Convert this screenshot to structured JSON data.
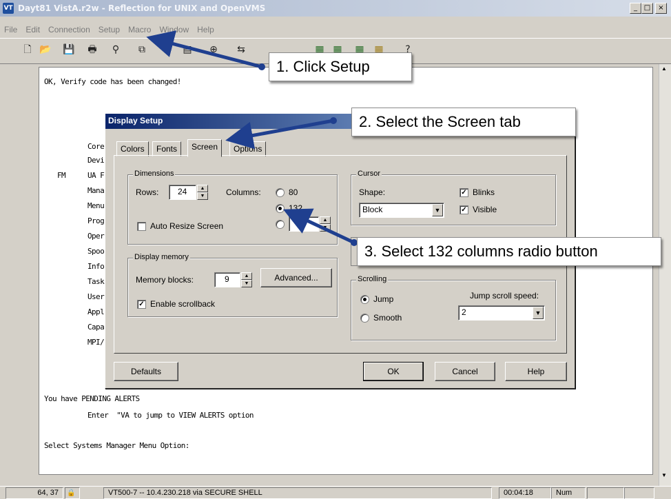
{
  "window": {
    "app_icon": "VT",
    "title": "Dayt81 VistA.r2w - Reflection for UNIX and OpenVMS",
    "min": "_",
    "max": "□",
    "close": "×"
  },
  "menu": [
    "File",
    "Edit",
    "Connection",
    "Setup",
    "Macro",
    "Window",
    "Help"
  ],
  "toolbar_icons": [
    "new-document-icon",
    "open-folder-icon",
    "save-icon",
    "print-icon",
    "find-icon",
    "copy-icon",
    "paste-icon",
    "connect-icon",
    "transfer-icon",
    "color-icon",
    "help-icon"
  ],
  "terminal": {
    "line_verify": "OK, Verify code has been changed!",
    "left_col": [
      "Core",
      "Devi",
      "UA F",
      "Mana",
      "Menu",
      "Prog",
      "Oper",
      "Spoo",
      "Info",
      "Task",
      "User",
      "Appl",
      "Capa",
      "MPI/"
    ],
    "fm": "FM",
    "pending": "You have PENDING ALERTS",
    "enter": "Enter  \"VA to jump to VIEW ALERTS option",
    "prompt": "Select Systems Manager Menu Option:"
  },
  "status": {
    "position": "64, 37",
    "lock": "🔒",
    "connection": "VT500-7 -- 10.4.230.218 via SECURE SHELL",
    "time": "00:04:18",
    "num": "Num"
  },
  "dialog": {
    "title": "Display Setup",
    "tabs": [
      "Colors",
      "Fonts",
      "Screen",
      "Options"
    ],
    "active_tab": "Screen",
    "dimensions": {
      "label": "Dimensions",
      "rows_label": "Rows:",
      "rows_value": "24",
      "columns_label": "Columns:",
      "col_options": [
        "80",
        "132",
        ""
      ],
      "selected": "132",
      "auto_resize": "Auto Resize Screen",
      "auto_resize_checked": false
    },
    "display_memory": {
      "label": "Display memory",
      "blocks_label": "Memory blocks:",
      "blocks_value": "9",
      "advanced": "Advanced...",
      "scrollback": "Enable scrollback",
      "scrollback_checked": true
    },
    "cursor": {
      "label": "Cursor",
      "shape_label": "Shape:",
      "shape_value": "Block",
      "blinks": "Blinks",
      "visible": "Visible"
    },
    "scrolling": {
      "label": "Scrolling",
      "jump": "Jump",
      "smooth": "Smooth",
      "selected": "Jump",
      "speed_label": "Jump scroll speed:",
      "speed_value": "2"
    },
    "buttons": {
      "defaults": "Defaults",
      "ok": "OK",
      "cancel": "Cancel",
      "help": "Help"
    }
  },
  "callouts": {
    "c1": "1. Click Setup",
    "c2": "2. Select the Screen tab",
    "c3": "3.  Select 132 columns radio button"
  },
  "colors": {
    "arrow": "#1f3f8f",
    "title_active": "#0a246a"
  }
}
